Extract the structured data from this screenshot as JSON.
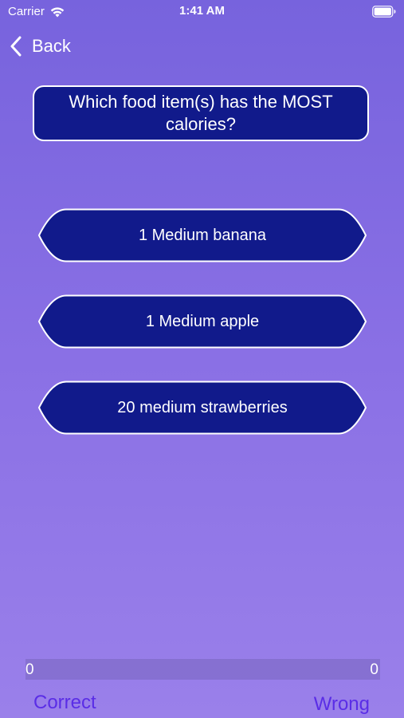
{
  "status_bar": {
    "carrier": "Carrier",
    "time": "1:41 AM",
    "wifi_icon": "wifi-icon",
    "battery_icon": "battery-icon"
  },
  "nav": {
    "back_label": "Back",
    "back_icon": "chevron-left-icon"
  },
  "question": {
    "text": "Which food item(s) has the MOST calories?"
  },
  "answers": [
    {
      "label": "1 Medium banana"
    },
    {
      "label": "1 Medium apple"
    },
    {
      "label": "20 medium strawberries"
    }
  ],
  "score": {
    "correct_count": "0",
    "wrong_count": "0",
    "correct_label": "Correct",
    "wrong_label": "Wrong"
  },
  "colors": {
    "background_top": "#7763dd",
    "background_bottom": "#9a80ea",
    "answer_fill": "#111a8b",
    "border": "#ffffff",
    "score_label": "#5a2de6"
  }
}
